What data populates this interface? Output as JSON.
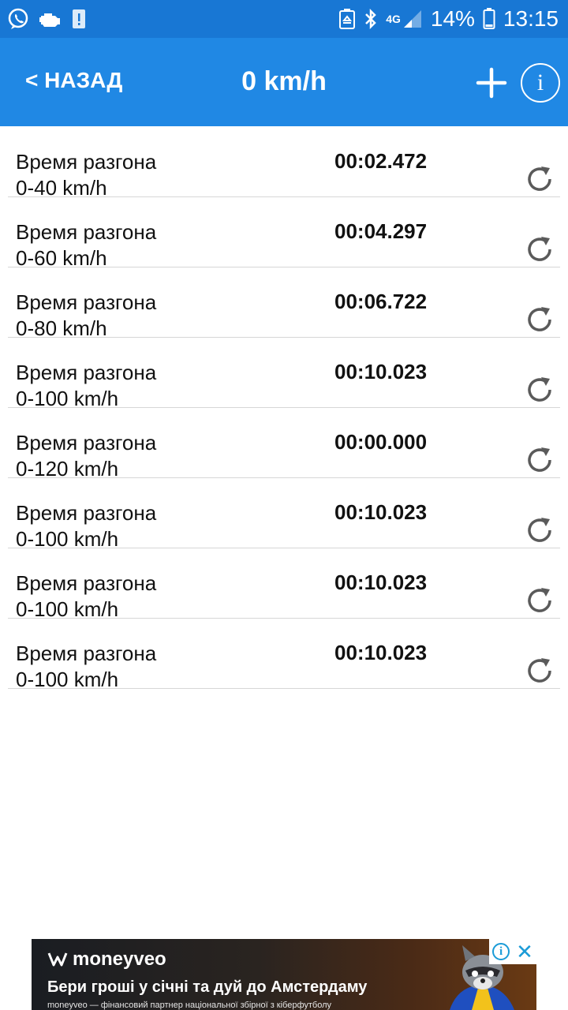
{
  "status_bar": {
    "icons_left": [
      "viber-icon",
      "engine-check-icon",
      "battery-alert-icon"
    ],
    "icons_right": [
      "recycle-icon",
      "bluetooth-icon",
      "4g-signal-icon"
    ],
    "network_label": "4G",
    "battery": "14%",
    "time": "13:15"
  },
  "app_bar": {
    "back_label": "< НАЗАД",
    "title": "0 km/h",
    "info_label": "i",
    "colors": {
      "status": "#1877d4",
      "toolbar": "#2088e4"
    }
  },
  "results": [
    {
      "label": "Время разгона",
      "range": "0-40 km/h",
      "time": "00:02.472"
    },
    {
      "label": "Время разгона",
      "range": "0-60 km/h",
      "time": "00:04.297"
    },
    {
      "label": "Время разгона",
      "range": "0-80 km/h",
      "time": "00:06.722"
    },
    {
      "label": "Время разгона",
      "range": "0-100 km/h",
      "time": "00:10.023"
    },
    {
      "label": "Время разгона",
      "range": "0-120 km/h",
      "time": "00:00.000"
    },
    {
      "label": "Время разгона",
      "range": "0-100 km/h",
      "time": "00:10.023"
    },
    {
      "label": "Время разгона",
      "range": "0-100 km/h",
      "time": "00:10.023"
    },
    {
      "label": "Время разгона",
      "range": "0-100 km/h",
      "time": "00:10.023"
    }
  ],
  "ad": {
    "brand": "moneyveo",
    "headline": "Бери гроші у січні та дуй до Амстердаму",
    "subtext": "moneyveo — фінансовий партнер національної збірної з кіберфутболу",
    "info_label": "i",
    "close_label": "✕"
  }
}
